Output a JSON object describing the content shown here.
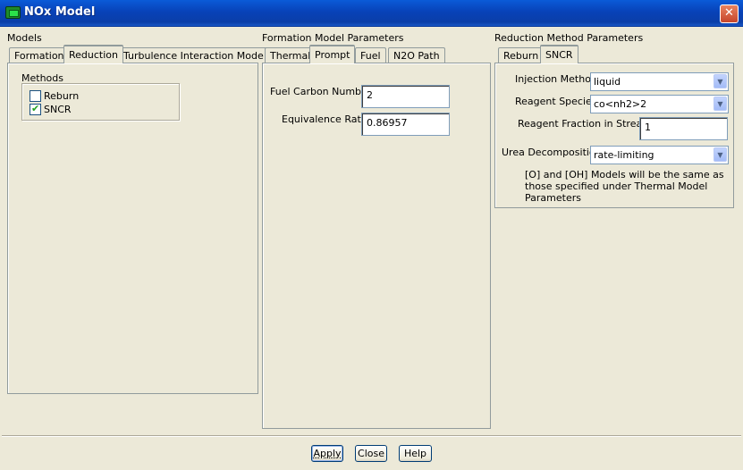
{
  "window": {
    "title": "NOx Model",
    "close_glyph": "✕"
  },
  "models": {
    "label": "Models",
    "tabs": [
      "Formation",
      "Reduction",
      "Turbulence Interaction Mode"
    ],
    "active_tab": "Reduction",
    "methods_label": "Methods",
    "methods": [
      {
        "label": "Reburn",
        "checked": false
      },
      {
        "label": "SNCR",
        "checked": true
      }
    ]
  },
  "formation": {
    "label": "Formation Model Parameters",
    "tabs": [
      "Thermal",
      "Prompt",
      "Fuel",
      "N2O Path"
    ],
    "active_tab": "Prompt",
    "fuel_carbon_label": "Fuel Carbon Number",
    "fuel_carbon_value": "2",
    "equivalence_label": "Equivalence Ratio",
    "equivalence_value": "0.86957"
  },
  "reduction": {
    "label": "Reduction Method Parameters",
    "tabs": [
      "Reburn",
      "SNCR"
    ],
    "active_tab": "SNCR",
    "injection_label": "Injection Method",
    "injection_value": "liquid",
    "reagent_label": "Reagent Species",
    "reagent_value": "co<nh2>2",
    "fraction_label": "Reagent Fraction in Stream",
    "fraction_value": "1",
    "urea_label": "Urea Decomposition",
    "urea_value": "rate-limiting",
    "note_lines": [
      "[O] and [OH] Models will be the same as",
      "those specified under Thermal Model",
      "Parameters"
    ]
  },
  "buttons": {
    "apply": "Apply",
    "close": "Close",
    "help": "Help"
  },
  "icons": {
    "app": "nox-model-app-icon",
    "close": "close-icon",
    "dropdown": "chevron-down-icon",
    "check": "checkmark-icon"
  },
  "colors": {
    "titlebar": "#0a4bc8",
    "dialog_bg": "#ece9d8",
    "close_button": "#d4502f",
    "check": "#21a121"
  }
}
